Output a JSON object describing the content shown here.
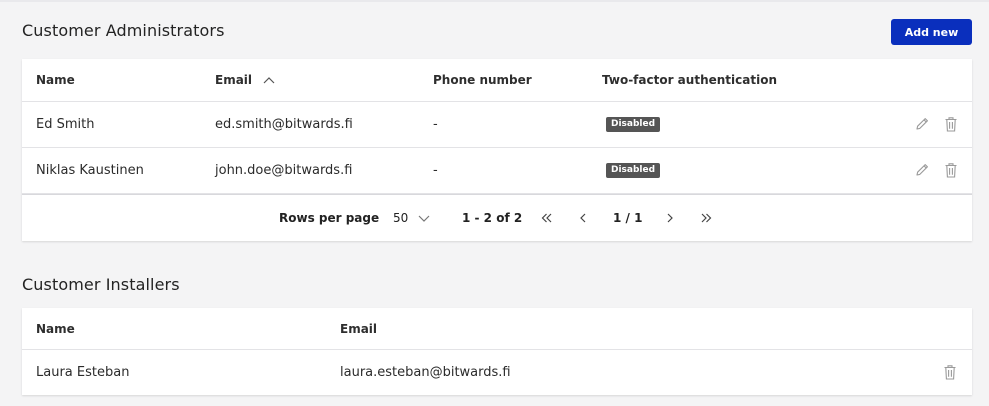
{
  "admins": {
    "title": "Customer Administrators",
    "add_button": "Add new",
    "columns": [
      "Name",
      "Email",
      "Phone number",
      "Two-factor authentication"
    ],
    "rows": [
      {
        "name": "Ed Smith",
        "email": "ed.smith@bitwards.fi",
        "phone": "-",
        "tfa": "Disabled"
      },
      {
        "name": "Niklas Kaustinen",
        "email": "john.doe@bitwards.fi",
        "phone": "-",
        "tfa": "Disabled"
      }
    ],
    "pagination": {
      "rows_per_page_label": "Rows per page",
      "rows_per_page_value": "50",
      "range": "1 - 2 of 2",
      "page": "1 / 1"
    }
  },
  "installers": {
    "title": "Customer Installers",
    "columns": [
      "Name",
      "Email"
    ],
    "rows": [
      {
        "name": "Laura Esteban",
        "email": "laura.esteban@bitwards.fi"
      }
    ]
  },
  "icons": {
    "sort": "chevron-up-icon",
    "edit": "pencil-icon",
    "delete": "trash-icon",
    "dropdown": "chevron-down-icon",
    "first": "double-chevron-left-icon",
    "prev": "chevron-left-icon",
    "next": "chevron-right-icon",
    "last": "double-chevron-right-icon"
  },
  "colors": {
    "primary": "#0a2fbd",
    "badge": "#555555",
    "background": "#f4f4f5"
  }
}
